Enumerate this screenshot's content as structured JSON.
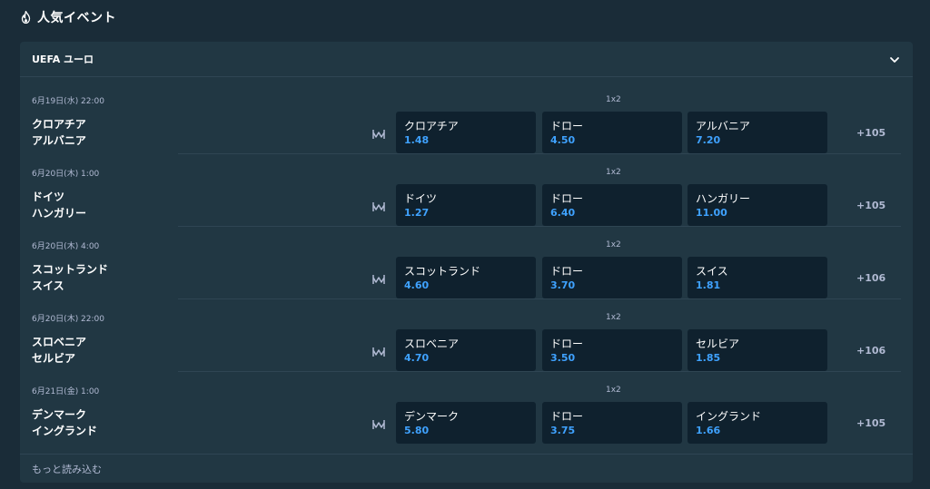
{
  "header": {
    "title": "人気イベント",
    "icon": "fire-icon"
  },
  "panel": {
    "league": "UEFA ユーロ",
    "collapse_icon": "chevron-down-icon",
    "load_more": "もっと読み込む"
  },
  "matches": [
    {
      "date": "6月19日(水) 22:00",
      "market": "1x2",
      "team1": "クロアチア",
      "team2": "アルバニア",
      "odds": [
        {
          "label": "クロアチア",
          "price": "1.48"
        },
        {
          "label": "ドロー",
          "price": "4.50"
        },
        {
          "label": "アルバニア",
          "price": "7.20"
        }
      ],
      "more": "+105"
    },
    {
      "date": "6月20日(木) 1:00",
      "market": "1x2",
      "team1": "ドイツ",
      "team2": "ハンガリー",
      "odds": [
        {
          "label": "ドイツ",
          "price": "1.27"
        },
        {
          "label": "ドロー",
          "price": "6.40"
        },
        {
          "label": "ハンガリー",
          "price": "11.00"
        }
      ],
      "more": "+105"
    },
    {
      "date": "6月20日(木) 4:00",
      "market": "1x2",
      "team1": "スコットランド",
      "team2": "スイス",
      "odds": [
        {
          "label": "スコットランド",
          "price": "4.60"
        },
        {
          "label": "ドロー",
          "price": "3.70"
        },
        {
          "label": "スイス",
          "price": "1.81"
        }
      ],
      "more": "+106"
    },
    {
      "date": "6月20日(木) 22:00",
      "market": "1x2",
      "team1": "スロベニア",
      "team2": "セルビア",
      "odds": [
        {
          "label": "スロベニア",
          "price": "4.70"
        },
        {
          "label": "ドロー",
          "price": "3.50"
        },
        {
          "label": "セルビア",
          "price": "1.85"
        }
      ],
      "more": "+106"
    },
    {
      "date": "6月21日(金) 1:00",
      "market": "1x2",
      "team1": "デンマーク",
      "team2": "イングランド",
      "odds": [
        {
          "label": "デンマーク",
          "price": "5.80"
        },
        {
          "label": "ドロー",
          "price": "3.75"
        },
        {
          "label": "イングランド",
          "price": "1.66"
        }
      ],
      "more": "+105"
    }
  ],
  "stats_icon": "stats-chart-icon",
  "colors": {
    "background": "#1a2c38",
    "panel": "#213743",
    "odds_button": "#0f212e",
    "price": "#3fa2ff",
    "muted_text": "#b1bad3",
    "divider": "#2f4553"
  }
}
